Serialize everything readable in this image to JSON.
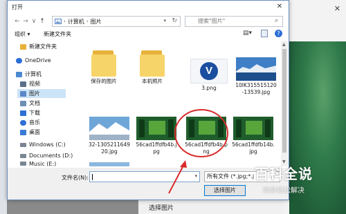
{
  "dialog": {
    "title": "打开",
    "close_glyph": "✕"
  },
  "nav": {
    "back": "←",
    "forward": "→",
    "recent": "∨",
    "up": "↑",
    "crumbs": [
      "计算机",
      "图片"
    ],
    "separator": "›",
    "refresh": "↻",
    "search_placeholder": "搜索\"图片\""
  },
  "toolbar": {
    "organize": "组织 ▾",
    "new_folder": "新建文件夹",
    "help": "?"
  },
  "sidebar": {
    "items": [
      {
        "label": "新建文件夹",
        "icon": "folder-icon",
        "color": "#e8b33a"
      },
      {
        "label": "OneDrive",
        "icon": "cloud-icon",
        "color": "#2b6ed8"
      },
      {
        "label": "计算机",
        "icon": "computer-icon",
        "color": "#4a8ad0"
      },
      {
        "label": "视频",
        "icon": "video-icon",
        "color": "#5a6f8a"
      },
      {
        "label": "图片",
        "icon": "pictures-icon",
        "color": "#5a88c8",
        "selected": true
      },
      {
        "label": "文档",
        "icon": "documents-icon",
        "color": "#6f8fb5"
      },
      {
        "label": "下载",
        "icon": "download-icon",
        "color": "#2f6fd6"
      },
      {
        "label": "音乐",
        "icon": "music-icon",
        "color": "#2f6fd6"
      },
      {
        "label": "桌面",
        "icon": "desktop-icon",
        "color": "#3a7bd5"
      },
      {
        "label": "Windows (C:)",
        "icon": "drive-icon",
        "color": "#7a8594"
      },
      {
        "label": "Documents (D:)",
        "icon": "drive-icon",
        "color": "#7a8594"
      },
      {
        "label": "Music (E:)",
        "icon": "drive-icon",
        "color": "#7a8594"
      }
    ]
  },
  "files": [
    {
      "label": "保存的图片",
      "kind": "folder"
    },
    {
      "label": "本机照片",
      "kind": "folder"
    },
    {
      "label": "3.png",
      "kind": "logo"
    },
    {
      "label": "10IK315515120-13539.jpg",
      "kind": "sky"
    },
    {
      "label": "32-130521164920.jpg",
      "kind": "mountain"
    },
    {
      "label": "56cad1ffdfb4b.jpg",
      "kind": "forest"
    },
    {
      "label": "56cad1ffdfb4b.png",
      "kind": "forest"
    },
    {
      "label": "56cad1ffdfb14b.jpg",
      "kind": "forest"
    }
  ],
  "bottom": {
    "filename_label": "文件名(N):",
    "filter_text": "所有文件 (*.jpg;*.j",
    "open_button": "选择图片"
  },
  "background": {
    "caption": "选择图片",
    "close_glyph": "✕"
  },
  "watermark": {
    "title": "百科全说",
    "subtitle": "助你轻松解决"
  },
  "colors": {
    "annotation": "#d82a2a",
    "selection": "#cce4f7",
    "accent": "#0078d7"
  }
}
